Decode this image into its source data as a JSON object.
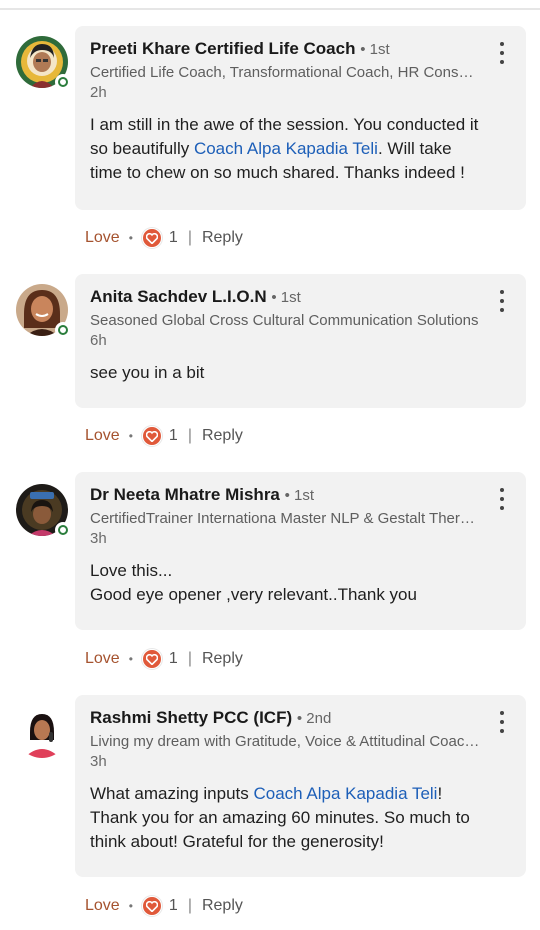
{
  "comments": [
    {
      "author": "Preeti Khare Certified Life Coach",
      "degree": "• 1st",
      "headline": "Certified Life Coach, Transformational Coach, HR Consultant",
      "time": "2h",
      "text_parts": [
        "I am still in the awe of the session. You conducted it so beautifully ",
        "Coach Alpa Kapadia Teli",
        ". Will take time to chew on so much shared. Thanks indeed !"
      ],
      "reaction_label": "Love",
      "reaction_count": "1",
      "reply_label": "Reply"
    },
    {
      "author": "Anita Sachdev  L.I.O.N",
      "degree": "• 1st",
      "headline": "Seasoned Global Cross Cultural Communication Solutions",
      "time": "6h",
      "text_parts": [
        "see you in a bit"
      ],
      "reaction_label": "Love",
      "reaction_count": "1",
      "reply_label": "Reply"
    },
    {
      "author": "Dr Neeta Mhatre Mishra",
      "degree": "• 1st",
      "headline": "CertifiedTrainer Internationa Master NLP & Gestalt Therapist",
      "time": "3h",
      "text_parts": [
        "Love this...",
        "Good eye opener ,very relevant..Thank you"
      ],
      "reaction_label": "Love",
      "reaction_count": "1",
      "reply_label": "Reply"
    },
    {
      "author": "Rashmi Shetty PCC (ICF)",
      "degree": "• 2nd",
      "headline": "Living my dream with Gratitude, Voice & Attitudinal Coaching",
      "time": "3h",
      "text_parts": [
        "What amazing inputs ",
        "Coach Alpa Kapadia Teli",
        "! Thank you for an amazing 60 minutes. So much to think about! Grateful for the generosity!"
      ],
      "reaction_label": "Love",
      "reaction_count": "1",
      "reply_label": "Reply"
    }
  ],
  "colors": {
    "bubble": "#f2f2f2",
    "mention": "#1d5fb8",
    "love": "#a5532f",
    "heart": "#e0593a",
    "online": "#2a7d3c"
  },
  "icons": [
    "more-options-icon",
    "heart-reaction-icon",
    "online-status-icon"
  ]
}
